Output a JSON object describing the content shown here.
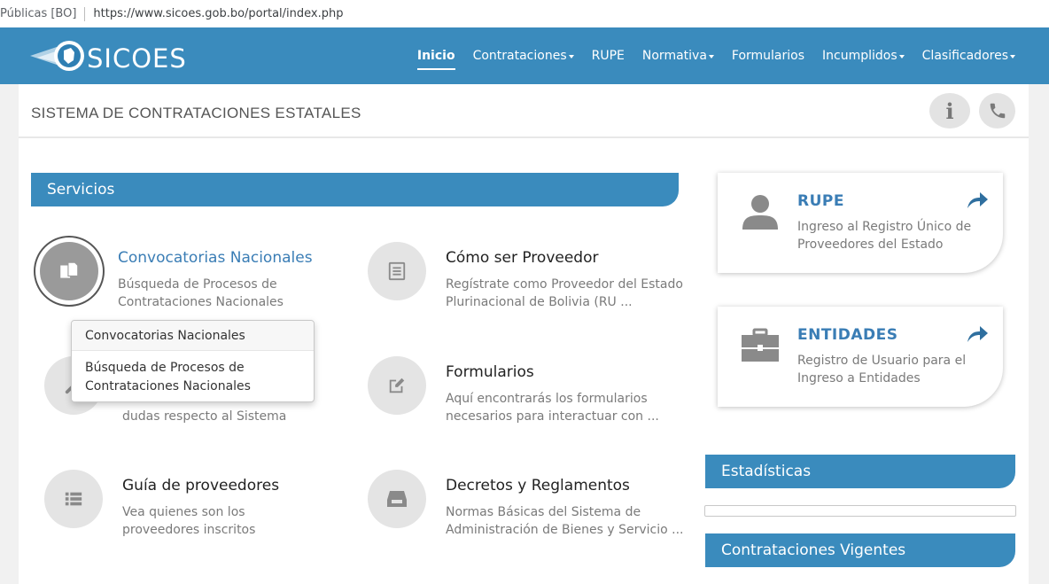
{
  "browser": {
    "tab_fragment": "Públicas [BO]",
    "url": "https://www.sicoes.gob.bo/portal/index.php"
  },
  "brand": {
    "logo_text": "SICOES",
    "nav_color": "#3a8bbd",
    "accent_text": "#3a7db5"
  },
  "nav": [
    {
      "label": "Inicio",
      "dropdown": false,
      "active": true
    },
    {
      "label": "Contrataciones",
      "dropdown": true
    },
    {
      "label": "RUPE",
      "dropdown": false
    },
    {
      "label": "Normativa",
      "dropdown": true
    },
    {
      "label": "Formularios",
      "dropdown": false
    },
    {
      "label": "Incumplidos",
      "dropdown": true
    },
    {
      "label": "Clasificadores",
      "dropdown": true
    }
  ],
  "header": {
    "title": "SISTEMA DE CONTRATACIONES ESTATALES",
    "info_icon": "info-icon",
    "phone_icon": "phone-icon"
  },
  "servicios": {
    "heading": "Servicios",
    "items": [
      {
        "title": "Convocatorias Nacionales",
        "desc": "Búsqueda de Procesos de Contrataciones Nacionales",
        "icon": "documents-icon"
      },
      {
        "title": "Cómo ser Proveedor",
        "desc": "Regístrate como Proveedor del Estado Plurinacional de Bolivia (RU ...",
        "icon": "list-doc-icon"
      },
      {
        "title": "",
        "desc": "dudas respecto al Sistema",
        "icon": "wrench-icon"
      },
      {
        "title": "Formularios",
        "desc": "Aquí encontrarás los formularios necesarios para interactuar con ...",
        "icon": "edit-icon"
      },
      {
        "title": "Guía de proveedores",
        "desc": "Vea quienes son los proveedores inscritos",
        "icon": "list-icon"
      },
      {
        "title": "Decretos y Reglamentos",
        "desc": "Normas Básicas del Sistema de Administración de Bienes y Servicio ...",
        "icon": "inbox-icon"
      }
    ]
  },
  "tooltip": {
    "title": "Convocatorias Nacionales",
    "body": "Búsqueda de Procesos de Contrataciones Nacionales"
  },
  "cards": [
    {
      "title": "RUPE",
      "desc": "Ingreso al Registro Único de Proveedores del Estado",
      "icon": "user-icon"
    },
    {
      "title": "ENTIDADES",
      "desc": "Registro de Usuario para el Ingreso a Entidades",
      "icon": "briefcase-icon"
    }
  ],
  "estadisticas": {
    "heading": "Estadísticas"
  },
  "vigentes": {
    "heading": "Contrataciones Vigentes"
  }
}
